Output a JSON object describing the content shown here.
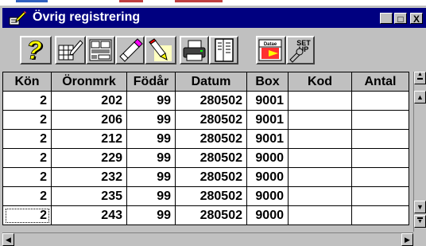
{
  "window": {
    "title": "Övrig registrering",
    "minimize_label": "_",
    "maximize_label": "□",
    "close_label": "X"
  },
  "toolbar": {
    "buttons": [
      {
        "name": "help-icon",
        "glyph": "?"
      },
      {
        "name": "edit-form-icon"
      },
      {
        "name": "grid-layout-icon"
      },
      {
        "name": "pencil-eraser-icon"
      },
      {
        "name": "highlighter-icon"
      },
      {
        "name": "printer-icon"
      },
      {
        "name": "document-list-icon"
      },
      {
        "name": "database-exit-icon",
        "text": "Datae"
      },
      {
        "name": "setup-icon",
        "text": "SET UP"
      }
    ]
  },
  "table": {
    "columns": [
      "Kön",
      "Öronmrk",
      "Födår",
      "Datum",
      "Box",
      "Kod",
      "Antal"
    ],
    "rows": [
      [
        "2",
        "202",
        "99",
        "280502",
        "9001",
        "",
        ""
      ],
      [
        "2",
        "206",
        "99",
        "280502",
        "9001",
        "",
        ""
      ],
      [
        "2",
        "212",
        "99",
        "280502",
        "9001",
        "",
        ""
      ],
      [
        "2",
        "229",
        "99",
        "280502",
        "9000",
        "",
        ""
      ],
      [
        "2",
        "232",
        "99",
        "280502",
        "9000",
        "",
        ""
      ],
      [
        "2",
        "235",
        "99",
        "280502",
        "9000",
        "",
        ""
      ],
      [
        "2",
        "243",
        "99",
        "280502",
        "9000",
        "",
        ""
      ]
    ]
  },
  "colors": {
    "titlebar": "#000080",
    "face": "#c0c0c0"
  }
}
